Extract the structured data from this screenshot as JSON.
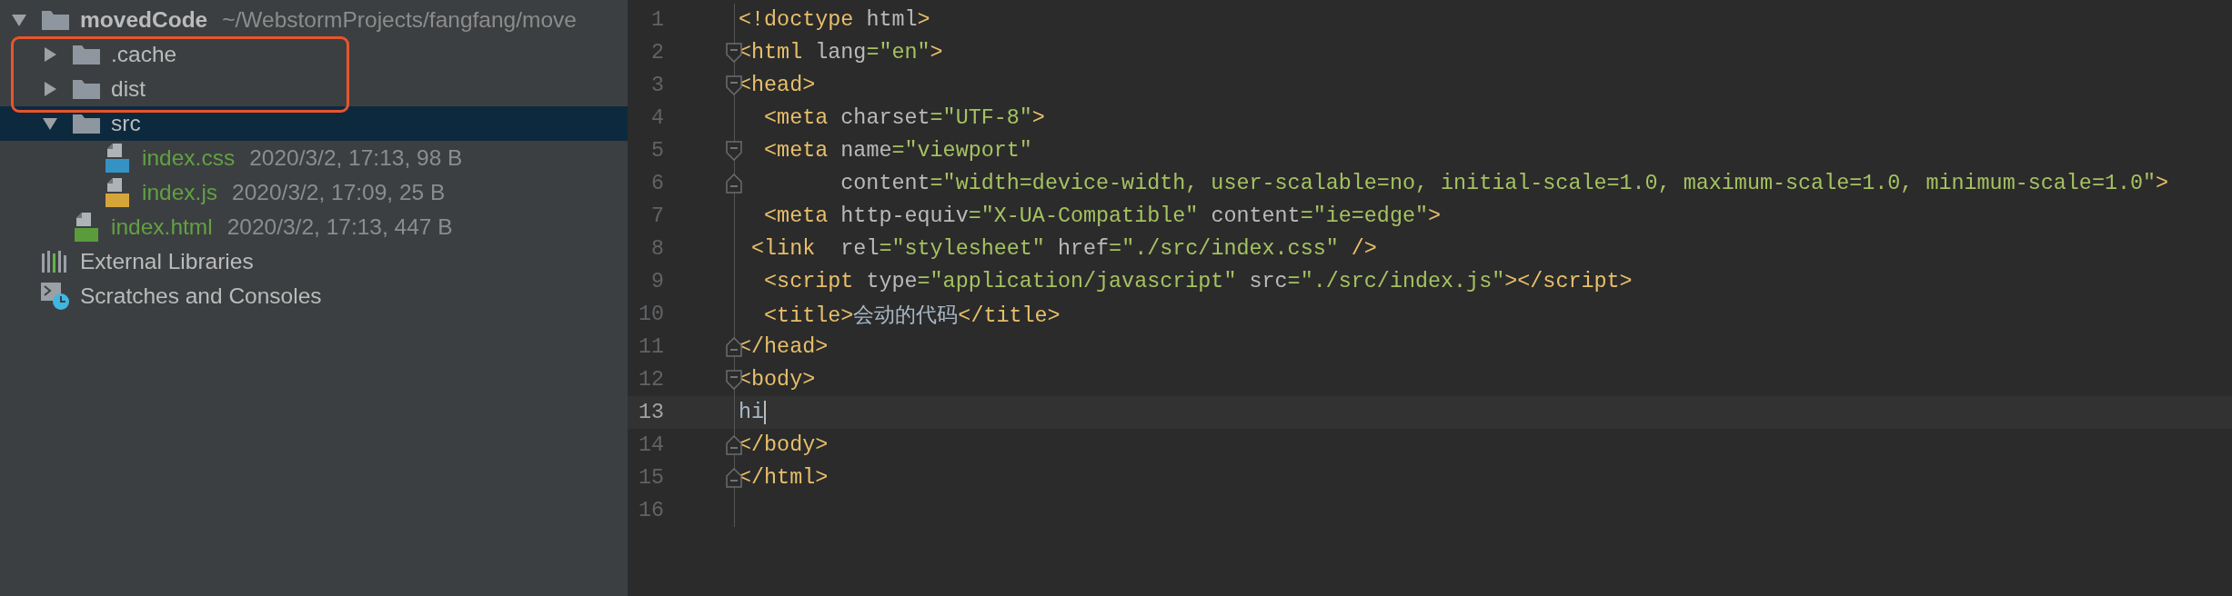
{
  "project_tree": {
    "items": [
      {
        "name": "movedCode",
        "path": "~/WebstormProjects/fangfang/move",
        "kind": "folder",
        "expanded": true,
        "selected": false,
        "highlighted": false,
        "children": [
          {
            "name": ".cache",
            "kind": "folder",
            "expanded": false,
            "selected": false,
            "highlighted": true
          },
          {
            "name": "dist",
            "kind": "folder",
            "expanded": false,
            "selected": false,
            "highlighted": true
          },
          {
            "name": "src",
            "kind": "folder",
            "expanded": true,
            "selected": true,
            "highlighted": false,
            "children": [
              {
                "name": "index.css",
                "info": "2020/3/2, 17:13, 98 B",
                "kind": "css",
                "selected": false,
                "highlighted": false
              },
              {
                "name": "index.js",
                "info": "2020/3/2, 17:09, 25 B",
                "kind": "js",
                "selected": false,
                "highlighted": false
              }
            ]
          },
          {
            "name": "index.html",
            "info": "2020/3/2, 17:13, 447 B",
            "kind": "html",
            "selected": false,
            "highlighted": false
          }
        ]
      },
      {
        "name": "External Libraries",
        "kind": "libraries",
        "selected": false,
        "highlighted": false
      },
      {
        "name": "Scratches and Consoles",
        "kind": "scratches",
        "selected": false,
        "highlighted": false
      }
    ]
  },
  "editor": {
    "lines": [
      {
        "number": "1",
        "kind": "plain",
        "current": false,
        "tokens": [
          {
            "kind": "tag",
            "text": "<!doctype"
          },
          {
            "kind": "attr",
            "text": " html"
          },
          {
            "kind": "tag",
            "text": ">"
          }
        ]
      },
      {
        "number": "2",
        "kind": "opener",
        "current": false,
        "tokens": [
          {
            "kind": "tag",
            "text": "<html"
          },
          {
            "kind": "attr",
            "text": " lang"
          },
          {
            "kind": "value",
            "text": "=\"en\""
          },
          {
            "kind": "tag",
            "text": ">"
          }
        ]
      },
      {
        "number": "3",
        "kind": "opener",
        "current": false,
        "tokens": [
          {
            "kind": "tag",
            "text": "<head>"
          }
        ]
      },
      {
        "number": "4",
        "kind": "plain",
        "current": false,
        "tokens": [
          {
            "kind": "tag",
            "text": "  <meta"
          },
          {
            "kind": "attr",
            "text": " charset"
          },
          {
            "kind": "value",
            "text": "=\"UTF-8\""
          },
          {
            "kind": "tag",
            "text": ">"
          }
        ]
      },
      {
        "number": "5",
        "kind": "opener",
        "current": false,
        "tokens": [
          {
            "kind": "tag",
            "text": "  <meta"
          },
          {
            "kind": "attr",
            "text": " name"
          },
          {
            "kind": "value",
            "text": "=\"viewport\""
          }
        ]
      },
      {
        "number": "6",
        "kind": "closer",
        "current": false,
        "tokens": [
          {
            "kind": "attr",
            "text": "        content"
          },
          {
            "kind": "value",
            "text": "=\"width=device-width, user-scalable=no, initial-scale=1.0, maximum-scale=1.0, minimum-scale=1.0\""
          },
          {
            "kind": "tag",
            "text": ">"
          }
        ]
      },
      {
        "number": "7",
        "kind": "plain",
        "current": false,
        "tokens": [
          {
            "kind": "tag",
            "text": "  <meta"
          },
          {
            "kind": "attr",
            "text": " http-equiv"
          },
          {
            "kind": "value",
            "text": "=\"X-UA-Compatible\""
          },
          {
            "kind": "attr",
            "text": " content"
          },
          {
            "kind": "value",
            "text": "=\"ie=edge\""
          },
          {
            "kind": "tag",
            "text": ">"
          }
        ]
      },
      {
        "number": "8",
        "kind": "plain",
        "current": false,
        "tokens": [
          {
            "kind": "tag",
            "text": " <link"
          },
          {
            "kind": "attr",
            "text": "  rel"
          },
          {
            "kind": "value",
            "text": "=\"stylesheet\""
          },
          {
            "kind": "attr",
            "text": " href"
          },
          {
            "kind": "value",
            "text": "=\"./src/index.css\""
          },
          {
            "kind": "tag",
            "text": " />"
          }
        ]
      },
      {
        "number": "9",
        "kind": "plain",
        "current": false,
        "tokens": [
          {
            "kind": "tag",
            "text": "  <script"
          },
          {
            "kind": "attr",
            "text": " type"
          },
          {
            "kind": "value",
            "text": "=\"application/javascript\""
          },
          {
            "kind": "attr",
            "text": " src"
          },
          {
            "kind": "value",
            "text": "=\"./src/index.js\""
          },
          {
            "kind": "tag",
            "text": "></script>"
          }
        ]
      },
      {
        "number": "10",
        "kind": "plain",
        "current": false,
        "tokens": [
          {
            "kind": "tag",
            "text": "  <title>"
          },
          {
            "kind": "text",
            "text": "会动的代码"
          },
          {
            "kind": "tag",
            "text": "</title>"
          }
        ]
      },
      {
        "number": "11",
        "kind": "closer",
        "current": false,
        "tokens": [
          {
            "kind": "tag",
            "text": "</head>"
          }
        ]
      },
      {
        "number": "12",
        "kind": "opener",
        "current": false,
        "tokens": [
          {
            "kind": "tag",
            "text": "<body>"
          }
        ]
      },
      {
        "number": "13",
        "kind": "plain",
        "current": true,
        "tokens": [
          {
            "kind": "text",
            "text": "hi"
          }
        ]
      },
      {
        "number": "14",
        "kind": "closer",
        "current": false,
        "tokens": [
          {
            "kind": "tag",
            "text": "</body>"
          }
        ]
      },
      {
        "number": "15",
        "kind": "closer",
        "current": false,
        "tokens": [
          {
            "kind": "tag",
            "text": "</html>"
          }
        ]
      },
      {
        "number": "16",
        "kind": "plain",
        "current": false
      }
    ]
  }
}
